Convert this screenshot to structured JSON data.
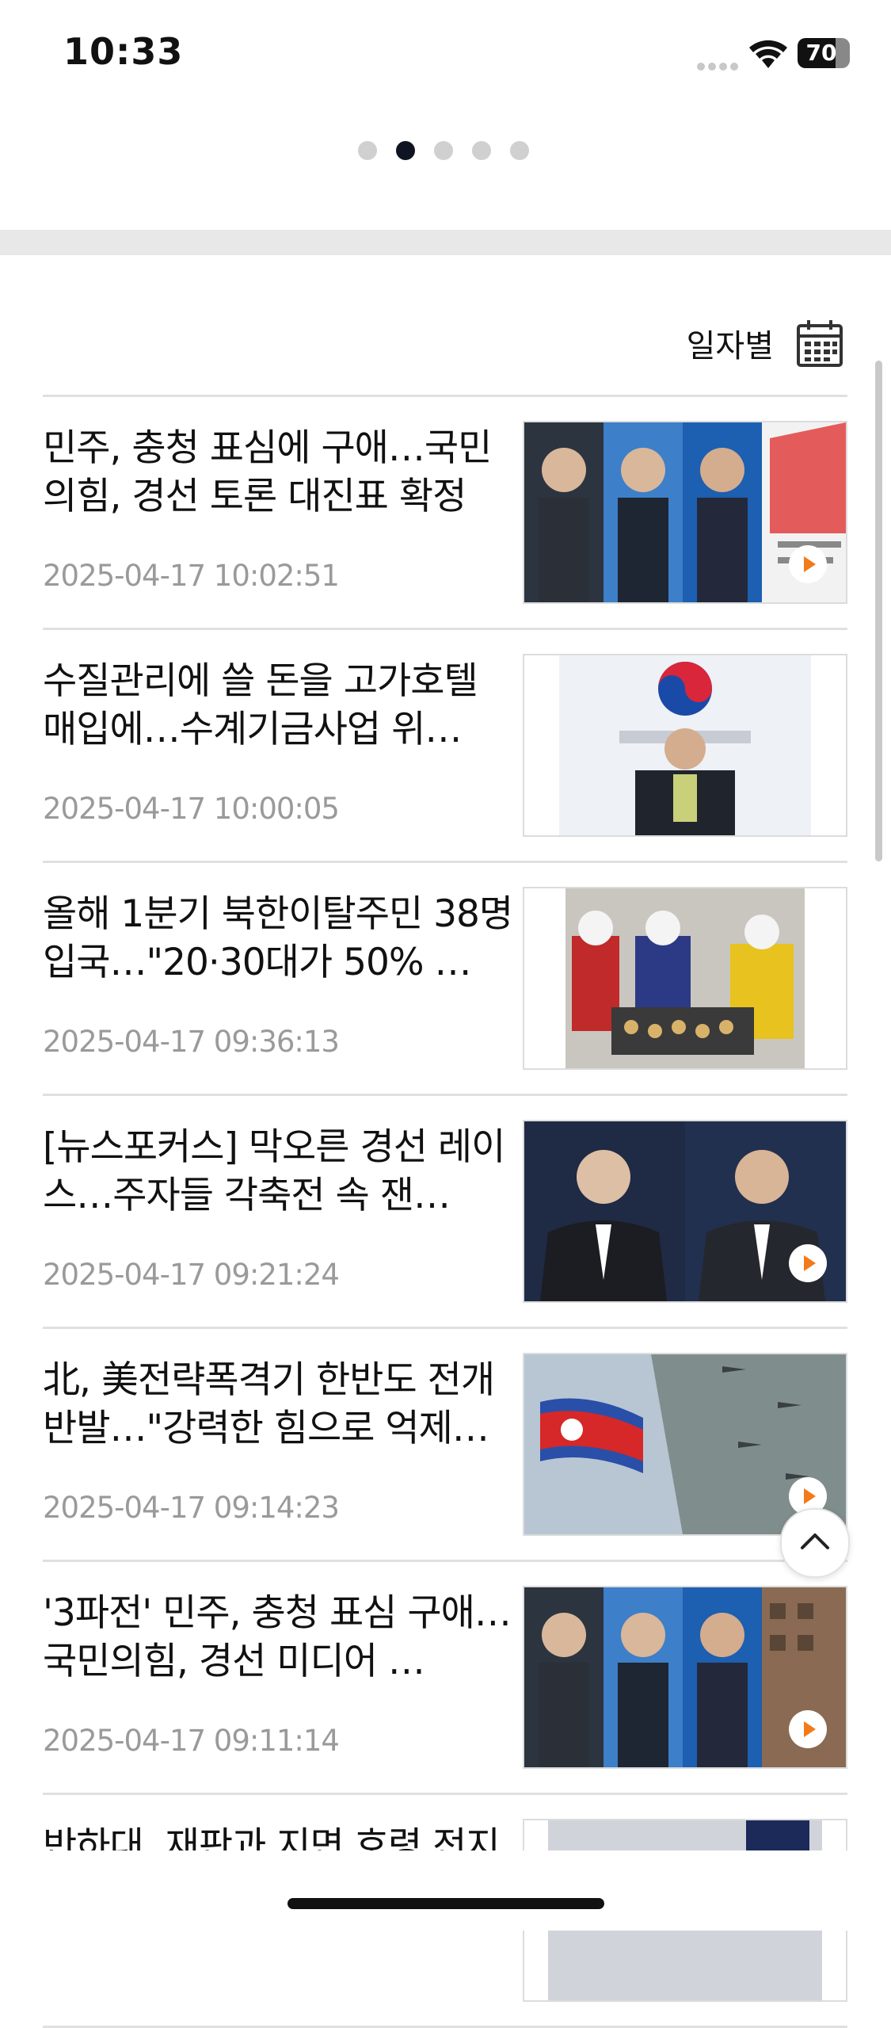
{
  "status_bar": {
    "time": "10:33",
    "battery": "70",
    "battery_level": 0.7
  },
  "pager": {
    "count": 5,
    "active_index": 1
  },
  "date_filter": {
    "label": "일자별",
    "icon": "calendar-icon"
  },
  "news": [
    {
      "title": "민주, 충청 표심에 구애…국민의힘, 경선 토론 대진표 확정",
      "date": "2025-04-17 10:02:51",
      "has_video": true
    },
    {
      "title": "수질관리에 쓸 돈을 고가호텔 매입에…수계기금사업 위…",
      "date": "2025-04-17 10:00:05",
      "has_video": false
    },
    {
      "title": "올해 1분기 북한이탈주민 38명 입국…\"20·30대가 50% …",
      "date": "2025-04-17 09:36:13",
      "has_video": false
    },
    {
      "title": "[뉴스포커스] 막오른 경선 레이스…주자들 각축전 속 잰…",
      "date": "2025-04-17 09:21:24",
      "has_video": true
    },
    {
      "title": "北, 美전략폭격기 한반도 전개 반발…\"강력한 힘으로 억제…",
      "date": "2025-04-17 09:14:23",
      "has_video": true
    },
    {
      "title": "'3파전' 민주, 충청 표심 구애…국민의힘, 경선 미디어 …",
      "date": "2025-04-17 09:11:14",
      "has_video": true
    },
    {
      "title": "반하대, 재판과 지면 호령 전지",
      "date": "",
      "has_video": false
    }
  ],
  "scroll_top": {
    "icon": "chevron-up-icon"
  }
}
